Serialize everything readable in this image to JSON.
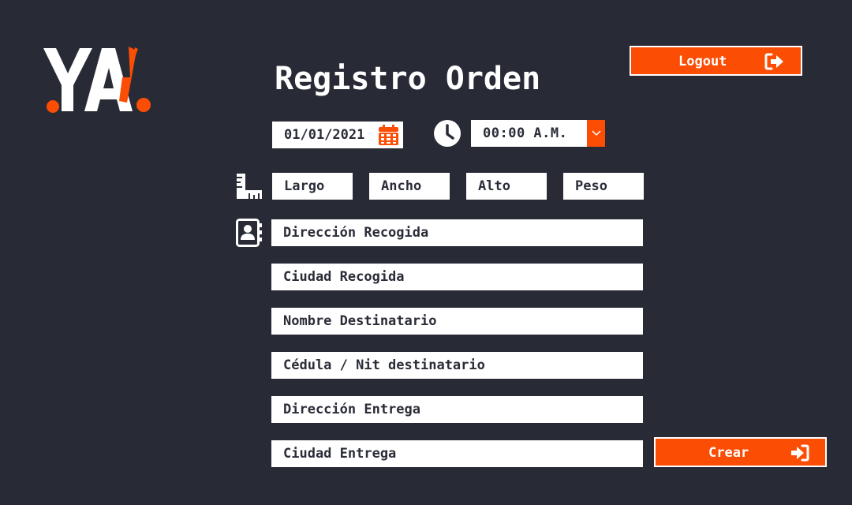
{
  "brand": {
    "logo_text": "YA!",
    "accent_color": "#fb4d04",
    "background_color": "#282b36"
  },
  "header": {
    "title": "Registro Orden",
    "logout_label": "Logout",
    "logout_icon": "sign-out-icon"
  },
  "schedule": {
    "date_value": "01/01/2021",
    "date_icon": "calendar-icon",
    "clock_icon": "clock-icon",
    "time_value": "00:00 A.M.",
    "time_dropdown_icon": "chevron-down-icon"
  },
  "dimensions": {
    "icon": "ruler-icon",
    "largo_placeholder": "Largo",
    "ancho_placeholder": "Ancho",
    "alto_placeholder": "Alto",
    "peso_placeholder": "Peso"
  },
  "address_form": {
    "icon": "contact-book-icon",
    "direccion_recogida_placeholder": "Dirección Recogida",
    "ciudad_recogida_placeholder": "Ciudad Recogida",
    "nombre_destinatario_placeholder": "Nombre Destinatario",
    "cedula_nit_placeholder": "Cédula / Nit destinatario",
    "direccion_entrega_placeholder": "Dirección Entrega",
    "ciudad_entrega_placeholder": "Ciudad Entrega"
  },
  "actions": {
    "crear_label": "Crear",
    "crear_icon": "sign-in-icon"
  }
}
